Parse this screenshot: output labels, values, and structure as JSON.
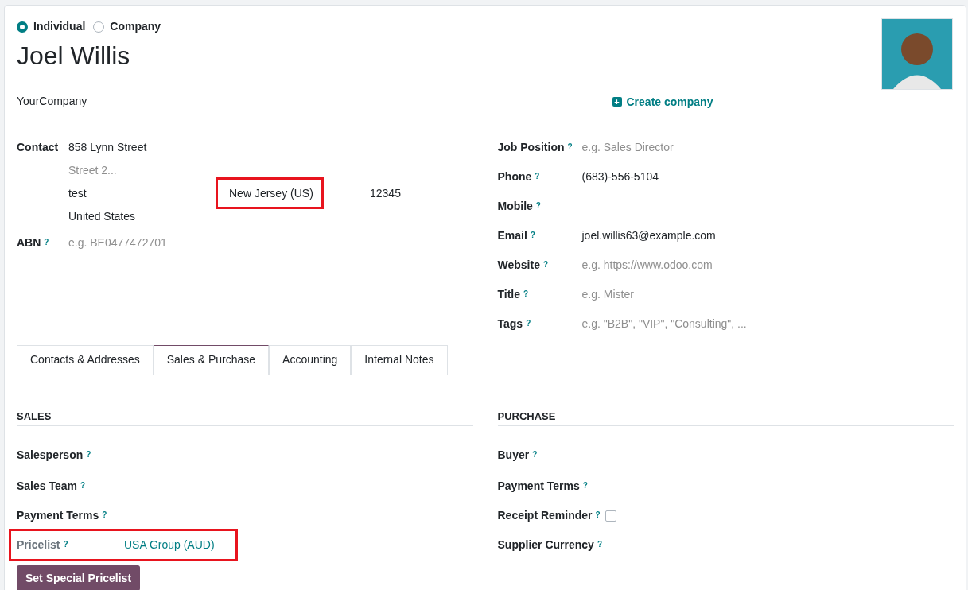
{
  "partner_type": [
    {
      "label": "Individual",
      "selected": true
    },
    {
      "label": "Company",
      "selected": false
    }
  ],
  "name": "Joel Willis",
  "company": "YourCompany",
  "create_company": {
    "icon": "+",
    "label": "Create company"
  },
  "contact": {
    "label": "Contact",
    "street": "858 Lynn Street",
    "street2_placeholder": "Street 2...",
    "city": "test",
    "state": {
      "value": "New Jersey (US)",
      "highlighted": true
    },
    "zip": "12345",
    "country": "United States"
  },
  "left_fields": [
    {
      "label": "ABN",
      "help": "?",
      "placeholder": "e.g. BE0477472701"
    }
  ],
  "right_fields": [
    {
      "label": "Job Position",
      "help": "?",
      "placeholder": "e.g. Sales Director"
    },
    {
      "label": "Phone",
      "help": "?",
      "value": "(683)-556-5104"
    },
    {
      "label": "Mobile",
      "help": "?"
    },
    {
      "label": "Email",
      "help": "?",
      "value": "joel.willis63@example.com"
    },
    {
      "label": "Website",
      "help": "?",
      "placeholder": "e.g. https://www.odoo.com"
    },
    {
      "label": "Title",
      "help": "?",
      "placeholder": "e.g. Mister"
    },
    {
      "label": "Tags",
      "help": "?",
      "placeholder": "e.g. \"B2B\", \"VIP\", \"Consulting\", ..."
    }
  ],
  "tabs": [
    {
      "label": "Contacts & Addresses",
      "selected": false
    },
    {
      "label": "Sales & Purchase",
      "selected": true
    },
    {
      "label": "Accounting",
      "selected": false
    },
    {
      "label": "Internal Notes",
      "selected": false
    }
  ],
  "sales": {
    "title": "SALES",
    "fields": [
      {
        "label": "Salesperson",
        "help": "?"
      },
      {
        "label": "Sales Team",
        "help": "?"
      },
      {
        "label": "Payment Terms",
        "help": "?"
      },
      {
        "label": "Pricelist",
        "help": "?",
        "value": "USA Group (AUD)",
        "muted": true,
        "highlighted": true
      }
    ],
    "button": "Set Special Pricelist"
  },
  "purchase": {
    "title": "PURCHASE",
    "fields": [
      {
        "label": "Buyer",
        "help": "?"
      },
      {
        "label": "Payment Terms",
        "help": "?"
      },
      {
        "label": "Receipt Reminder",
        "help": "?",
        "kind": "checkbox",
        "checked": false
      },
      {
        "label": "Supplier Currency",
        "help": "?"
      }
    ]
  }
}
